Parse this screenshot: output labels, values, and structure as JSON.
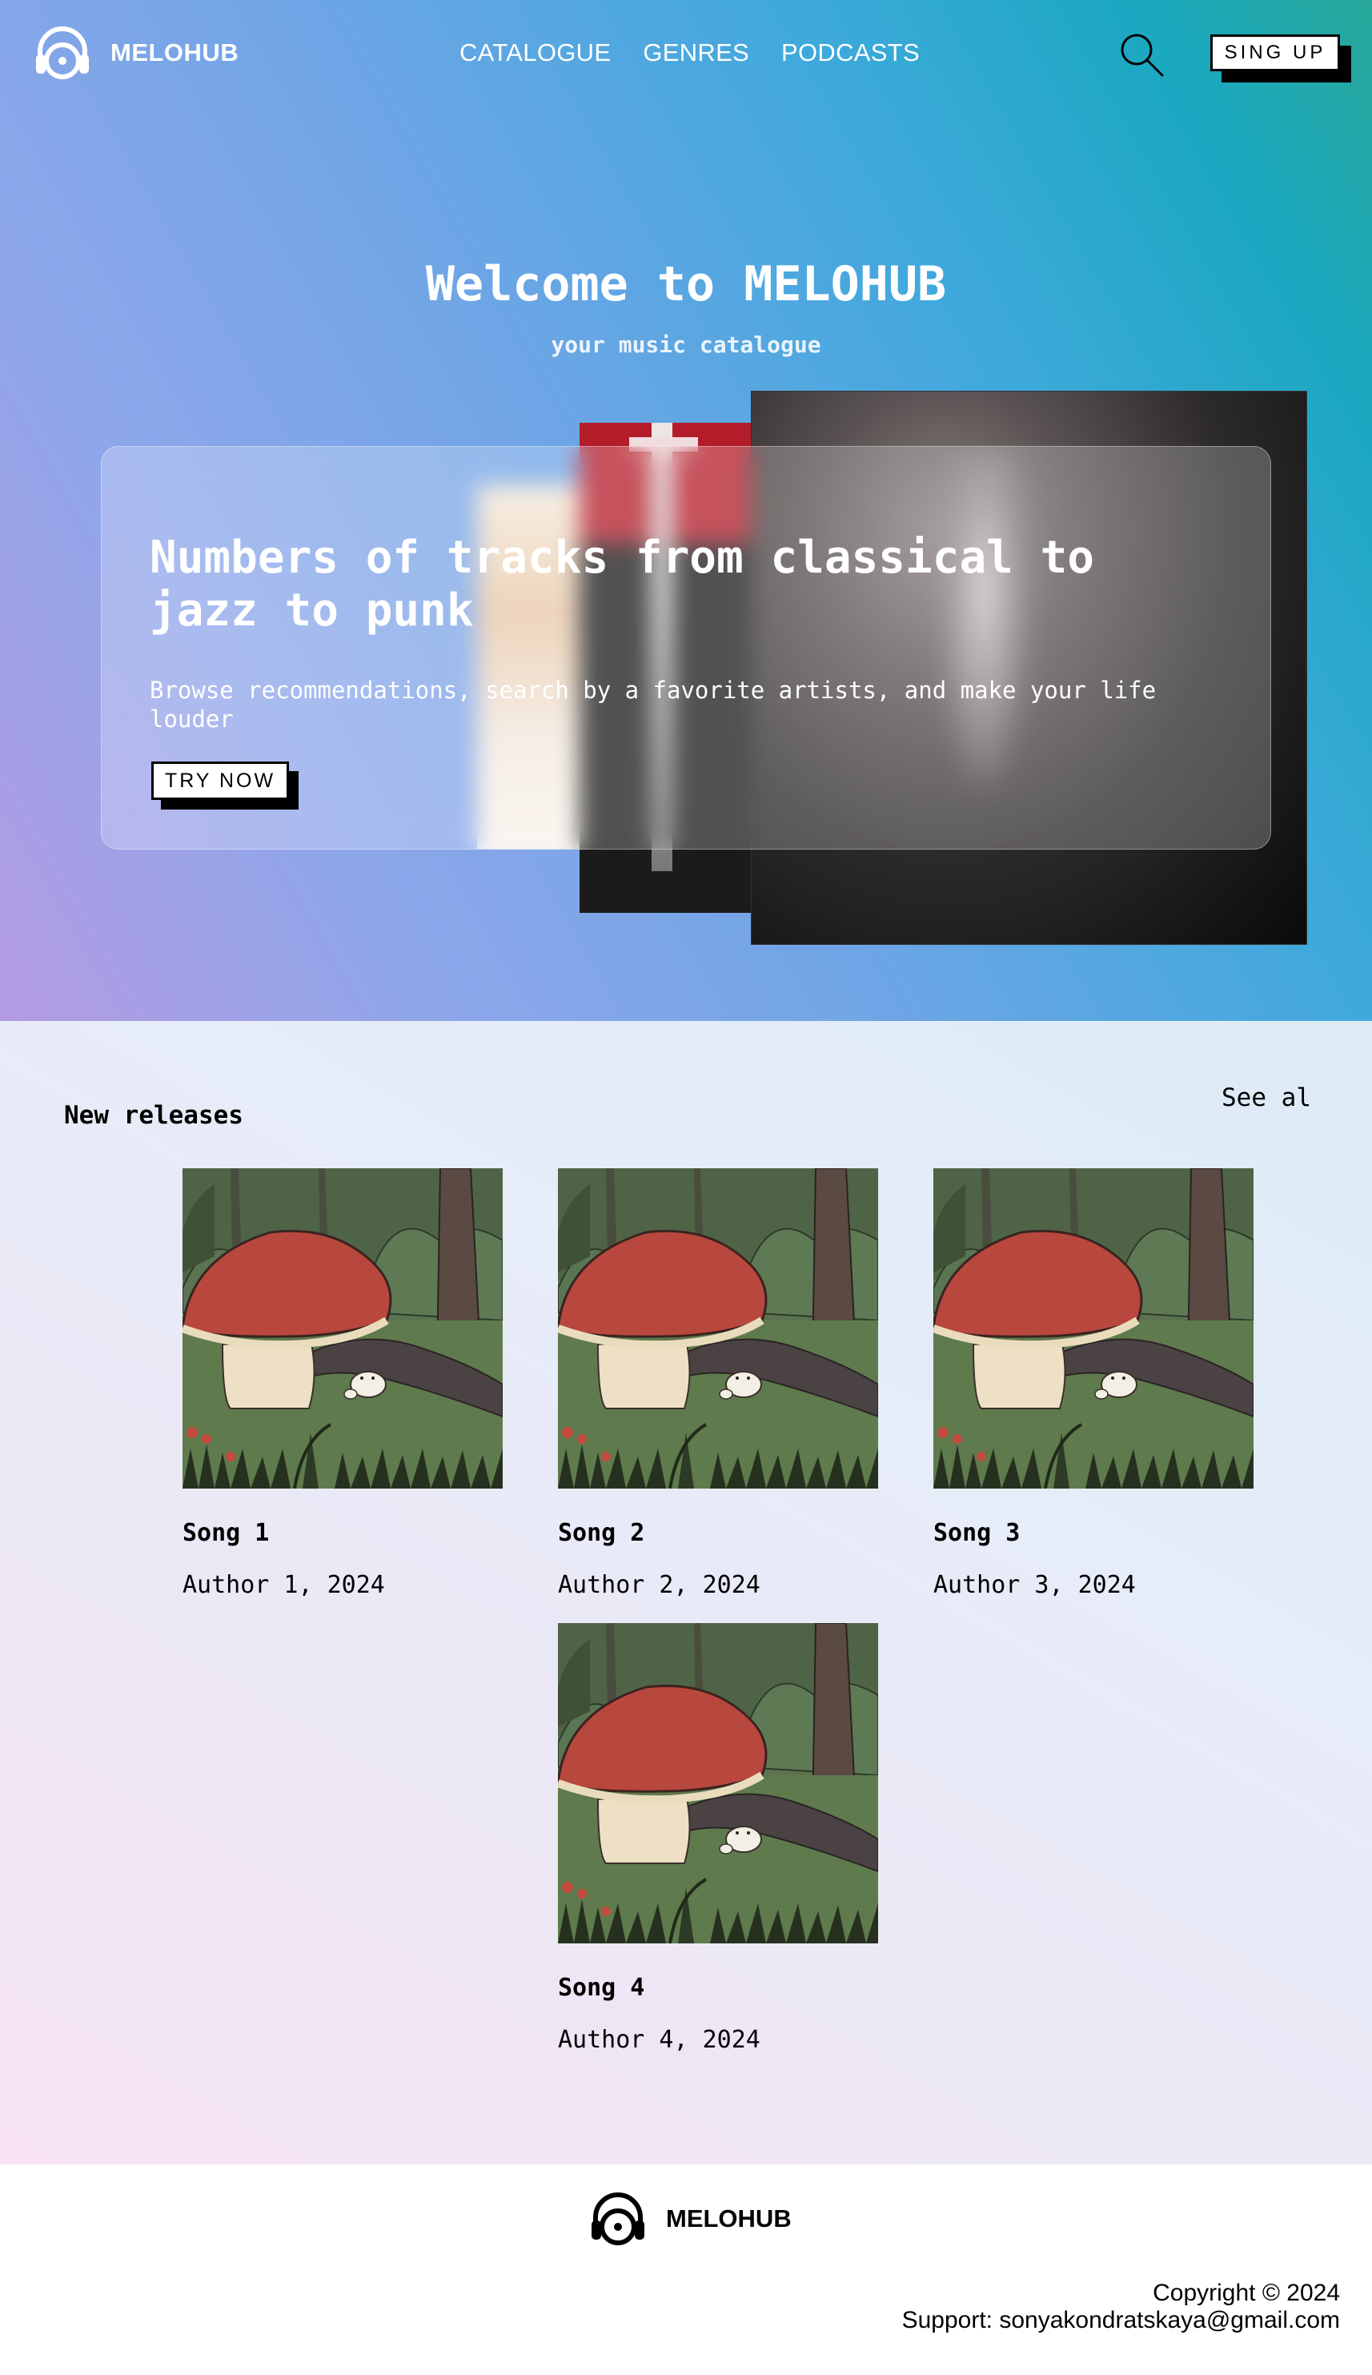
{
  "brand": {
    "name": "MELOHUB",
    "icon": "headphones-icon"
  },
  "nav": {
    "links": [
      {
        "label": "CATALOGUE"
      },
      {
        "label": "GENRES"
      },
      {
        "label": "PODCASTS"
      }
    ],
    "search_icon": "search-icon",
    "signup_label": "SING UP"
  },
  "hero": {
    "title": "Welcome to MELOHUB",
    "subtitle": "your music catalogue",
    "card": {
      "heading": "Numbers of tracks from classical to jazz to punk",
      "text": "Browse recommendations, search by a favorite artists, and make your life louder",
      "button_label": "TRY NOW"
    }
  },
  "releases": {
    "title": "New releases",
    "see_all_label": "See al",
    "songs": [
      {
        "title": "Song 1",
        "meta": "Author 1, 2024"
      },
      {
        "title": "Song 2",
        "meta": "Author 2, 2024"
      },
      {
        "title": "Song 3",
        "meta": "Author 3, 2024"
      },
      {
        "title": "Song 4",
        "meta": "Author 4, 2024"
      }
    ]
  },
  "footer": {
    "brand": "MELOHUB",
    "copyright": "Copyright © 2024",
    "support": "Support: sonyakondratskaya@gmail.com"
  },
  "colors": {
    "hero_gradient": [
      "#b49be3",
      "#6fa5e6",
      "#1aa8c0",
      "#27a89a"
    ],
    "button_bg": "#ffffff",
    "button_shadow": "#000000"
  }
}
